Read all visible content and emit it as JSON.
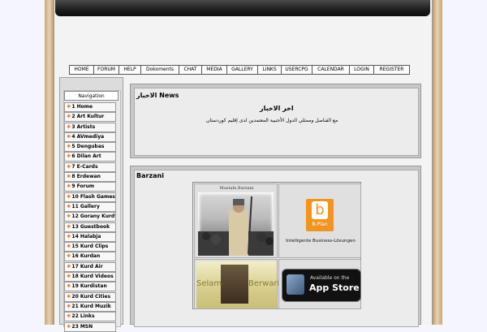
{
  "nav": [
    "HOME",
    "FORUM",
    "HELP",
    "Dokoments",
    "CHAT",
    "MEDIA",
    "GALLERY",
    "LINKS",
    "USERCPG",
    "CALENDAR",
    "LOGIN",
    "REGISTER"
  ],
  "sidebar": {
    "title": "Navigation",
    "items": [
      "1 Home",
      "2 Art Kultur",
      "3 Artists",
      "4 AVmediya",
      "5 Dengubas",
      "6 Dilan Art",
      "7 E-Cards",
      "8 Erdewan",
      "9 Forum",
      "10 Flash Games",
      "11 Gallery",
      "12 Gorany Kurdy",
      "13 Guestbook",
      "14 Halabja",
      "15 Kurd Clips",
      "16 Kurdan",
      "17 Kurd Air",
      "18 Kurd Videos",
      "19 Kurdistan",
      "20 Kurd Cities",
      "21 Kurd Muzik",
      "22 Links",
      "23 MSN"
    ]
  },
  "news": {
    "title": "الاخبار News",
    "heading": "اخر الاخبار",
    "line": "مع القناصل وممثلي الدول الأجنبية المعتمدين لدى إقليم كوردستان"
  },
  "barzani": {
    "title": "Barzani",
    "photo_caption": "Mustafa Barzani",
    "bplan_name": "B-Plan",
    "bplan_letter": "b",
    "bplan_tagline": "Intelligente Business-Lösungen",
    "selam": "Selam",
    "berwari": "Berwari",
    "appstore_small": "Available on the",
    "appstore_big": "App Store"
  }
}
